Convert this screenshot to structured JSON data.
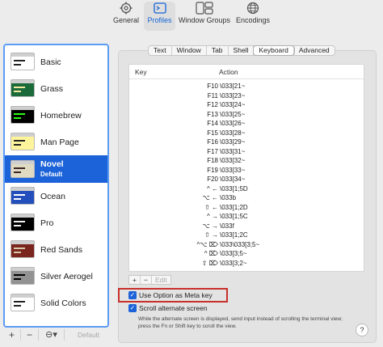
{
  "toolbar": {
    "items": [
      {
        "label": "General",
        "icon": "gear-icon",
        "active": false
      },
      {
        "label": "Profiles",
        "icon": "profiles-icon",
        "active": true
      },
      {
        "label": "Window Groups",
        "icon": "window-groups-icon",
        "active": false
      },
      {
        "label": "Encodings",
        "icon": "globe-icon",
        "active": false
      }
    ]
  },
  "profiles": [
    {
      "name": "Basic",
      "sub": ""
    },
    {
      "name": "Grass",
      "sub": ""
    },
    {
      "name": "Homebrew",
      "sub": ""
    },
    {
      "name": "Man Page",
      "sub": ""
    },
    {
      "name": "Novel",
      "sub": "Default"
    },
    {
      "name": "Ocean",
      "sub": ""
    },
    {
      "name": "Pro",
      "sub": ""
    },
    {
      "name": "Red Sands",
      "sub": ""
    },
    {
      "name": "Silver Aerogel",
      "sub": ""
    },
    {
      "name": "Solid Colors",
      "sub": ""
    }
  ],
  "selected_profile": "Novel",
  "profile_colors": {
    "Basic": "#ffffff",
    "Grass": "#1b6b3a",
    "Homebrew": "#000000",
    "Man Page": "#fef49c",
    "Novel": "#dfdbc3",
    "Ocean": "#224fbc",
    "Pro": "#000000",
    "Red Sands": "#7a251e",
    "Silver Aerogel": "#929292",
    "Solid Colors": "#ffffff"
  },
  "sidebar_buttons": {
    "add": "+",
    "remove": "−",
    "more": "⊖▾",
    "default": "Default"
  },
  "tabs": [
    "Text",
    "Window",
    "Tab",
    "Shell",
    "Keyboard",
    "Advanced"
  ],
  "active_tab": "Keyboard",
  "table": {
    "col_key": "Key",
    "col_action": "Action",
    "rows": [
      {
        "key": "F10",
        "action": "\\033[21~"
      },
      {
        "key": "F11",
        "action": "\\033[23~"
      },
      {
        "key": "F12",
        "action": "\\033[24~"
      },
      {
        "key": "F13",
        "action": "\\033[25~"
      },
      {
        "key": "F14",
        "action": "\\033[26~"
      },
      {
        "key": "F15",
        "action": "\\033[28~"
      },
      {
        "key": "F16",
        "action": "\\033[29~"
      },
      {
        "key": "F17",
        "action": "\\033[31~"
      },
      {
        "key": "F18",
        "action": "\\033[32~"
      },
      {
        "key": "F19",
        "action": "\\033[33~"
      },
      {
        "key": "F20",
        "action": "\\033[34~"
      },
      {
        "key": "^ ←",
        "action": "\\033[1;5D"
      },
      {
        "key": "⌥ ←",
        "action": "\\033b"
      },
      {
        "key": "⇧ ←",
        "action": "\\033[1;2D"
      },
      {
        "key": "^ →",
        "action": "\\033[1;5C"
      },
      {
        "key": "⌥ →",
        "action": "\\033f"
      },
      {
        "key": "⇧ →",
        "action": "\\033[1;2C"
      },
      {
        "key": "^⌥ ⌦",
        "action": "\\033\\033[3;5~"
      },
      {
        "key": "^ ⌦",
        "action": "\\033[3;5~"
      },
      {
        "key": "⇧ ⌦",
        "action": "\\033[3;2~"
      }
    ]
  },
  "table_buttons": {
    "add": "+",
    "remove": "−",
    "edit": "Edit"
  },
  "options": {
    "meta_key": "Use Option as Meta key",
    "scroll_alt": "Scroll alternate screen",
    "hint": "While the alternate screen is displayed, send input instead of scrolling the terminal view; press the Fn or Shift key to scroll the view."
  },
  "help": "?"
}
